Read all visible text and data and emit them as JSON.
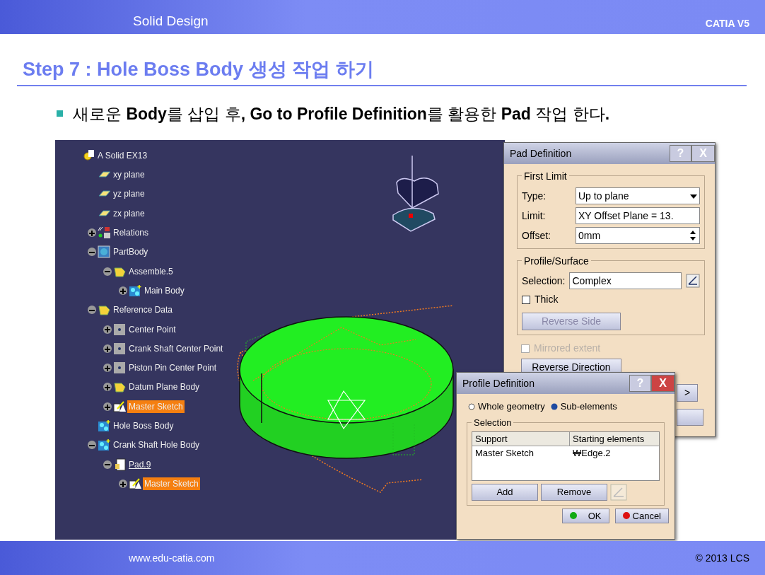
{
  "header": {
    "section": "Solid Design",
    "product": "CATIA V5"
  },
  "title": "Step 7 : Hole Boss Body 생성 작업 하기",
  "bullet": "새로운 **Body**를 삽입 후**, Go to Profile Definition**를 활용한 **Pad** 작업 한다**.**",
  "tree": {
    "label": "A Solid EX13",
    "kind": "part",
    "highlighted": false,
    "current": false,
    "children": [
      {
        "label": "xy plane",
        "kind": "plane",
        "highlighted": false,
        "current": false
      },
      {
        "label": "yz plane",
        "kind": "plane",
        "highlighted": false,
        "current": false
      },
      {
        "label": "zx plane",
        "kind": "plane",
        "highlighted": false,
        "current": false
      },
      {
        "label": "Relations",
        "kind": "relations",
        "expanded": false,
        "highlighted": false,
        "current": false
      },
      {
        "label": "PartBody",
        "kind": "body",
        "expanded": true,
        "highlighted": false,
        "current": false,
        "children": [
          {
            "label": "Assemble.5",
            "kind": "assembly",
            "expanded": true,
            "highlighted": false,
            "current": false,
            "children": [
              {
                "label": "Main Body",
                "kind": "newbody",
                "expanded": false,
                "highlighted": false,
                "current": false
              }
            ]
          }
        ]
      },
      {
        "label": "Reference Data",
        "kind": "assembly",
        "expanded": true,
        "highlighted": false,
        "current": false,
        "children": [
          {
            "label": "Center Point",
            "kind": "point",
            "expanded": false,
            "highlighted": false,
            "current": false
          },
          {
            "label": "Crank Shaft Center Point",
            "kind": "point",
            "expanded": false,
            "highlighted": false,
            "current": false
          },
          {
            "label": "Piston Pin Center Point",
            "kind": "point",
            "expanded": false,
            "highlighted": false,
            "current": false
          },
          {
            "label": "Datum Plane Body",
            "kind": "assembly",
            "expanded": false,
            "highlighted": false,
            "current": false
          },
          {
            "label": "Master Sketch",
            "kind": "sketch",
            "expanded": false,
            "highlighted": true,
            "current": false
          }
        ]
      },
      {
        "label": "Hole Boss Body",
        "kind": "newbody",
        "highlighted": false,
        "current": false
      },
      {
        "label": "Crank Shaft Hole Body",
        "kind": "newbody",
        "expanded": true,
        "highlighted": false,
        "current": false,
        "children": [
          {
            "label": "Pad.9",
            "kind": "pad",
            "expanded": true,
            "highlighted": false,
            "current": true,
            "children": [
              {
                "label": "Master Sketch",
                "kind": "sketch",
                "expanded": false,
                "highlighted": true,
                "current": false
              }
            ]
          }
        ]
      }
    ]
  },
  "pad_dialog": {
    "title": "Pad Definition",
    "help": "?",
    "close": "X",
    "first_limit": {
      "legend": "First Limit",
      "type_label": "Type:",
      "type_value": "Up to plane",
      "limit_label": "Limit:",
      "limit_value": "XY Offset Plane = 13.",
      "offset_label": "Offset:",
      "offset_value": "0mm"
    },
    "profile": {
      "legend": "Profile/Surface",
      "selection_label": "Selection:",
      "selection_value": "Complex",
      "thick": {
        "label": "Thick",
        "checked": false,
        "disabled": false
      },
      "reverse_side": {
        "label": "Reverse Side",
        "disabled": true
      }
    },
    "mirrored": {
      "label": "Mirrored extent",
      "checked": false,
      "disabled": true
    },
    "reverse_direction": {
      "label": "Reverse Direction",
      "disabled": false
    },
    "more": ">"
  },
  "profile_dialog": {
    "title": "Profile Definition",
    "help": "?",
    "close": "X",
    "options": [
      {
        "label": "Whole geometry",
        "selected": false
      },
      {
        "label": "Sub-elements",
        "selected": true
      }
    ],
    "legend": "Selection",
    "columns": [
      "Support",
      "Starting elements"
    ],
    "rows": [
      [
        "Master Sketch",
        "₩Edge.2"
      ]
    ],
    "buttons": [
      {
        "label": "Add"
      },
      {
        "label": "Remove"
      }
    ],
    "ok": "OK",
    "cancel": "Cancel"
  },
  "footer": {
    "site": "www.edu-catia.com",
    "copyright": "© 2013 LCS"
  }
}
